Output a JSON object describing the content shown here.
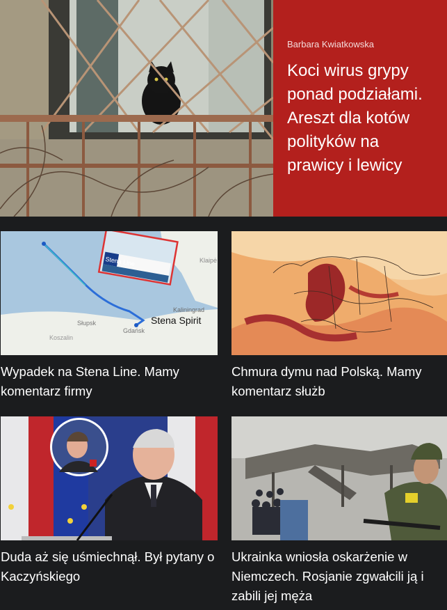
{
  "theme": {
    "accent": "#b3201d",
    "background": "#1b1c1e",
    "text": "#ffffff"
  },
  "hero": {
    "author": "Barbara Kwiatkowska",
    "title": "Koci wirus grypy ponad podziałami. Areszt dla kotów polityków na prawicy i lewicy",
    "image_icon": "cat-in-window-photo"
  },
  "articles": [
    {
      "headline": "Wypadek na Stena Line. Mamy komentarz firmy",
      "map_labels": {
        "ship": "Stena Spirit",
        "city1": "Kaliningrad",
        "city2": "Słupsk",
        "city3": "Koszalin",
        "city4": "Gdańsk",
        "city5": "Klaipė",
        "ferry_brand": "Stena Line"
      }
    },
    {
      "headline": "Chmura dymu nad Polską. Mamy komentarz służb"
    },
    {
      "headline": "Duda aż się uśmiechnął. Był pytany o Kaczyńskiego"
    },
    {
      "headline": "Ukrainka wniosła oskarżenie w Niemczech. Rosjanie zgwałcili ją i zabili jej męża"
    }
  ]
}
